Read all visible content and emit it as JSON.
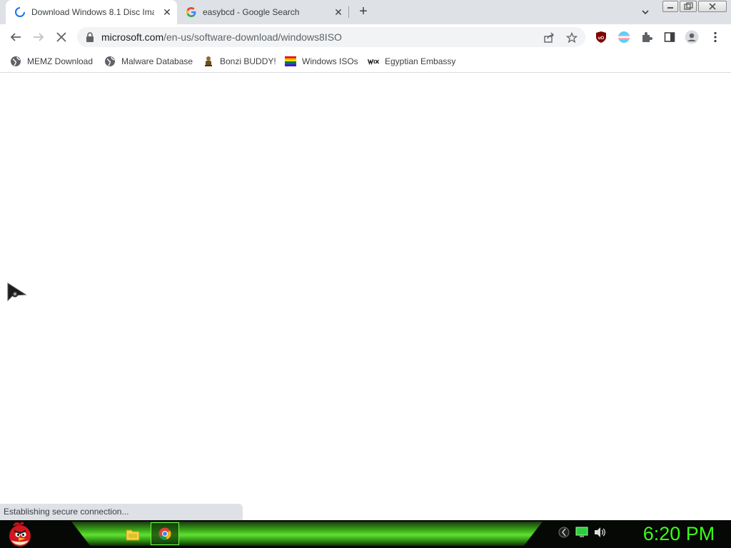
{
  "browser": {
    "tabs": [
      {
        "title": "Download Windows 8.1 Disc Ima",
        "active": true,
        "loading": true
      },
      {
        "title": "easybcd - Google Search",
        "active": false,
        "icon": "google-icon"
      }
    ],
    "new_tab": "+",
    "close_glyph": "✕",
    "url_host": "microsoft.com",
    "url_path": "/en-us/software-download/windows8ISO",
    "status_text": "Establishing secure connection..."
  },
  "bookmarks": [
    {
      "label": "MEMZ Download",
      "icon": "globe-icon"
    },
    {
      "label": "Malware Database",
      "icon": "globe-icon"
    },
    {
      "label": "Bonzi BUDDY!",
      "icon": "bonzi-icon"
    },
    {
      "label": "Windows ISOs",
      "icon": "rainbow-flag-icon"
    },
    {
      "label": "Egyptian Embassy",
      "icon": "wix-icon"
    }
  ],
  "taskbar": {
    "clock": "6:20 PM",
    "accent": "#39ff14"
  }
}
